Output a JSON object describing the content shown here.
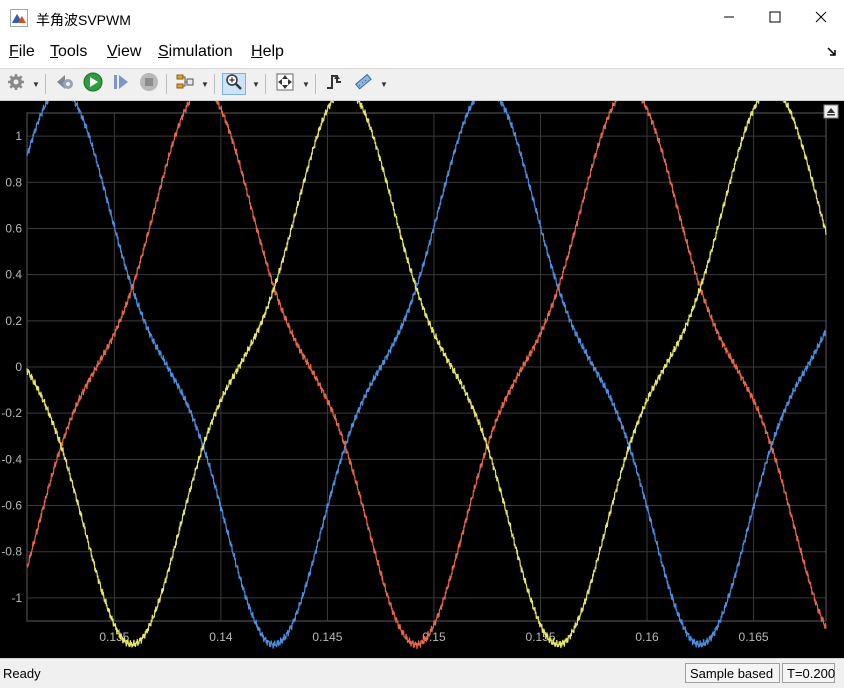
{
  "window": {
    "title": "羊角波SVPWM",
    "icon": "matlab-scope-icon",
    "controls": [
      "minimize-icon",
      "maximize-icon",
      "close-icon"
    ]
  },
  "menu": [
    {
      "label": "File",
      "u": "F",
      "rest": "ile"
    },
    {
      "label": "Tools",
      "u": "T",
      "rest": "ools"
    },
    {
      "label": "View",
      "u": "V",
      "rest": "iew"
    },
    {
      "label": "Simulation",
      "u": "S",
      "rest": "imulation"
    },
    {
      "label": "Help",
      "u": "H",
      "rest": "elp"
    }
  ],
  "toolbar": {
    "icons": [
      "configuration-gear-icon",
      "step-back-icon",
      "run-icon",
      "step-forward-icon",
      "stop-icon",
      "signal-selector-icon",
      "zoom-in-icon",
      "autoscale-icon",
      "triggers-icon",
      "measurements-icon"
    ],
    "active": "zoom-in-icon"
  },
  "status": {
    "ready": "Ready",
    "mode": "Sample based",
    "time": "T=0.200"
  },
  "colors": {
    "background": "#000000",
    "grid": "#3a3a3a",
    "tick_label": "#b8b8b8",
    "series_blue": "#4a8fe0",
    "series_orange": "#e8674a",
    "series_yellow": "#e6e66a"
  },
  "chart_data": {
    "type": "line",
    "title": "",
    "xlabel": "",
    "ylabel": "",
    "xlim": [
      0.1309,
      0.1684
    ],
    "ylim": [
      -1.1,
      1.1
    ],
    "x_ticks": [
      "0.135",
      "0.14",
      "0.145",
      "0.15",
      "0.155",
      "0.16",
      "0.165"
    ],
    "x_tick_values": [
      0.135,
      0.14,
      0.145,
      0.15,
      0.155,
      0.16,
      0.165
    ],
    "y_ticks": [
      "1",
      "0.8",
      "0.6",
      "0.4",
      "0.2",
      "0",
      "-0.2",
      "-0.4",
      "-0.6",
      "-0.8",
      "-1"
    ],
    "y_tick_values": [
      1,
      0.8,
      0.6,
      0.4,
      0.2,
      0,
      -0.2,
      -0.4,
      -0.6,
      -0.8,
      -1
    ],
    "grid": true,
    "frequency_hz": 50,
    "series": [
      {
        "color": "#4a8fe0",
        "phase_deg": 0,
        "amplitude": 1.03,
        "third_harmonic": 0.167
      },
      {
        "color": "#e8674a",
        "phase_deg": -120,
        "amplitude": 1.03,
        "third_harmonic": 0.167
      },
      {
        "color": "#e6e66a",
        "phase_deg": 120,
        "amplitude": 1.03,
        "third_harmonic": 0.167
      }
    ]
  }
}
